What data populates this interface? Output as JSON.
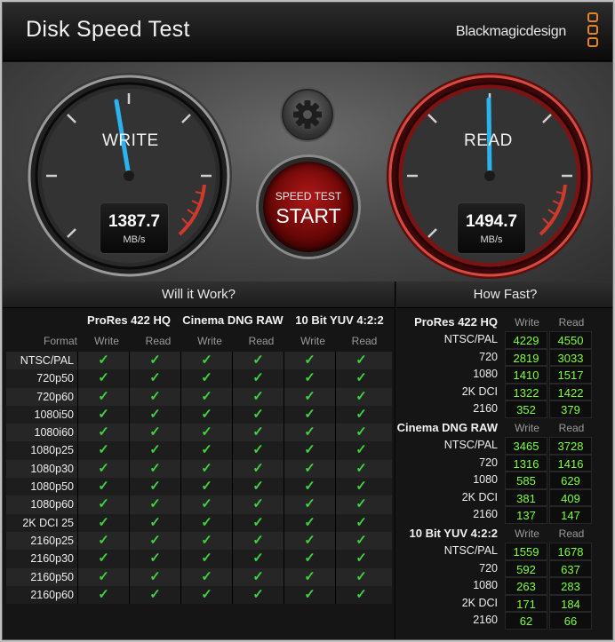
{
  "app": {
    "title": "Disk Speed Test",
    "brand": "Blackmagicdesign"
  },
  "colors": {
    "accent_red": "#d0392b",
    "needle": "#2bb3ef",
    "check_green": "#3fd43f",
    "number_green": "#7fff3a",
    "logo_orange": "#e8841f"
  },
  "gauges": {
    "write": {
      "label": "WRITE",
      "value": "1387.7",
      "unit": "MB/s"
    },
    "read": {
      "label": "READ",
      "value": "1494.7",
      "unit": "MB/s"
    }
  },
  "controls": {
    "settings_icon": "gear-icon",
    "start_small": "SPEED TEST",
    "start_big": "START"
  },
  "will_it_work": {
    "title": "Will it Work?",
    "format_label": "Format",
    "codecs": [
      "ProRes 422 HQ",
      "Cinema DNG RAW",
      "10 Bit YUV 4:2:2"
    ],
    "col_labels": [
      "Write",
      "Read",
      "Write",
      "Read",
      "Write",
      "Read"
    ],
    "check_symbol": "✓",
    "rows": [
      {
        "format": "NTSC/PAL",
        "checks": [
          true,
          true,
          true,
          true,
          true,
          true
        ]
      },
      {
        "format": "720p50",
        "checks": [
          true,
          true,
          true,
          true,
          true,
          true
        ]
      },
      {
        "format": "720p60",
        "checks": [
          true,
          true,
          true,
          true,
          true,
          true
        ]
      },
      {
        "format": "1080i50",
        "checks": [
          true,
          true,
          true,
          true,
          true,
          true
        ]
      },
      {
        "format": "1080i60",
        "checks": [
          true,
          true,
          true,
          true,
          true,
          true
        ]
      },
      {
        "format": "1080p25",
        "checks": [
          true,
          true,
          true,
          true,
          true,
          true
        ]
      },
      {
        "format": "1080p30",
        "checks": [
          true,
          true,
          true,
          true,
          true,
          true
        ]
      },
      {
        "format": "1080p50",
        "checks": [
          true,
          true,
          true,
          true,
          true,
          true
        ]
      },
      {
        "format": "1080p60",
        "checks": [
          true,
          true,
          true,
          true,
          true,
          true
        ]
      },
      {
        "format": "2K DCI 25",
        "checks": [
          true,
          true,
          true,
          true,
          true,
          true
        ]
      },
      {
        "format": "2160p25",
        "checks": [
          true,
          true,
          true,
          true,
          true,
          true
        ]
      },
      {
        "format": "2160p30",
        "checks": [
          true,
          true,
          true,
          true,
          true,
          true
        ]
      },
      {
        "format": "2160p50",
        "checks": [
          true,
          true,
          true,
          true,
          true,
          true
        ]
      },
      {
        "format": "2160p60",
        "checks": [
          true,
          true,
          true,
          true,
          true,
          true
        ]
      }
    ]
  },
  "how_fast": {
    "title": "How Fast?",
    "sections": [
      {
        "codec": "ProRes 422 HQ",
        "write_label": "Write",
        "read_label": "Read",
        "rows": [
          {
            "format": "NTSC/PAL",
            "write": "4229",
            "read": "4550"
          },
          {
            "format": "720",
            "write": "2819",
            "read": "3033"
          },
          {
            "format": "1080",
            "write": "1410",
            "read": "1517"
          },
          {
            "format": "2K DCI",
            "write": "1322",
            "read": "1422"
          },
          {
            "format": "2160",
            "write": "352",
            "read": "379"
          }
        ]
      },
      {
        "codec": "Cinema DNG RAW",
        "write_label": "Write",
        "read_label": "Read",
        "rows": [
          {
            "format": "NTSC/PAL",
            "write": "3465",
            "read": "3728"
          },
          {
            "format": "720",
            "write": "1316",
            "read": "1416"
          },
          {
            "format": "1080",
            "write": "585",
            "read": "629"
          },
          {
            "format": "2K DCI",
            "write": "381",
            "read": "409"
          },
          {
            "format": "2160",
            "write": "137",
            "read": "147"
          }
        ]
      },
      {
        "codec": "10 Bit YUV 4:2:2",
        "write_label": "Write",
        "read_label": "Read",
        "rows": [
          {
            "format": "NTSC/PAL",
            "write": "1559",
            "read": "1678"
          },
          {
            "format": "720",
            "write": "592",
            "read": "637"
          },
          {
            "format": "1080",
            "write": "263",
            "read": "283"
          },
          {
            "format": "2K DCI",
            "write": "171",
            "read": "184"
          },
          {
            "format": "2160",
            "write": "62",
            "read": "66"
          }
        ]
      }
    ]
  }
}
